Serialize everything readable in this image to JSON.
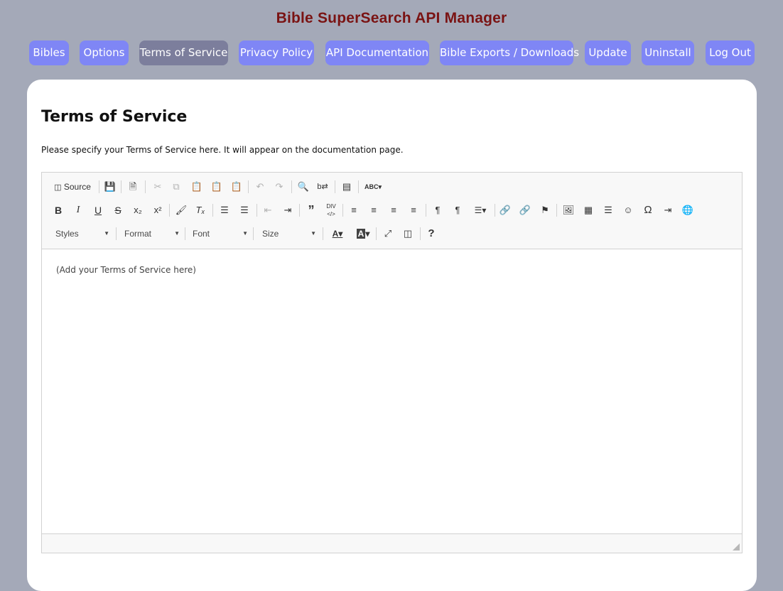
{
  "app": {
    "title": "Bible SuperSearch API Manager"
  },
  "nav": [
    {
      "label": "Bibles",
      "active": false
    },
    {
      "label": "Options",
      "active": false
    },
    {
      "label": "Terms of Service",
      "active": true
    },
    {
      "label": "Privacy Policy",
      "active": false
    },
    {
      "label": "API Documentation",
      "active": false
    },
    {
      "label": "Bible Exports / Downloads",
      "active": false
    },
    {
      "label": "Update",
      "active": false
    },
    {
      "label": "Uninstall",
      "active": false
    },
    {
      "label": "Log Out",
      "active": false
    }
  ],
  "page": {
    "title": "Terms of Service",
    "description": "Please specify your Terms of Service here. It will appear on the documentation page."
  },
  "editor": {
    "source_label": "Source",
    "styles_label": "Styles",
    "format_label": "Format",
    "font_label": "Font",
    "size_label": "Size",
    "content": "(Add your Terms of Service here)"
  },
  "colors": {
    "background": "#a4a9b8",
    "title": "#7a1313",
    "nav_button": "#7f86f5",
    "nav_active": "#7c7e9c"
  }
}
